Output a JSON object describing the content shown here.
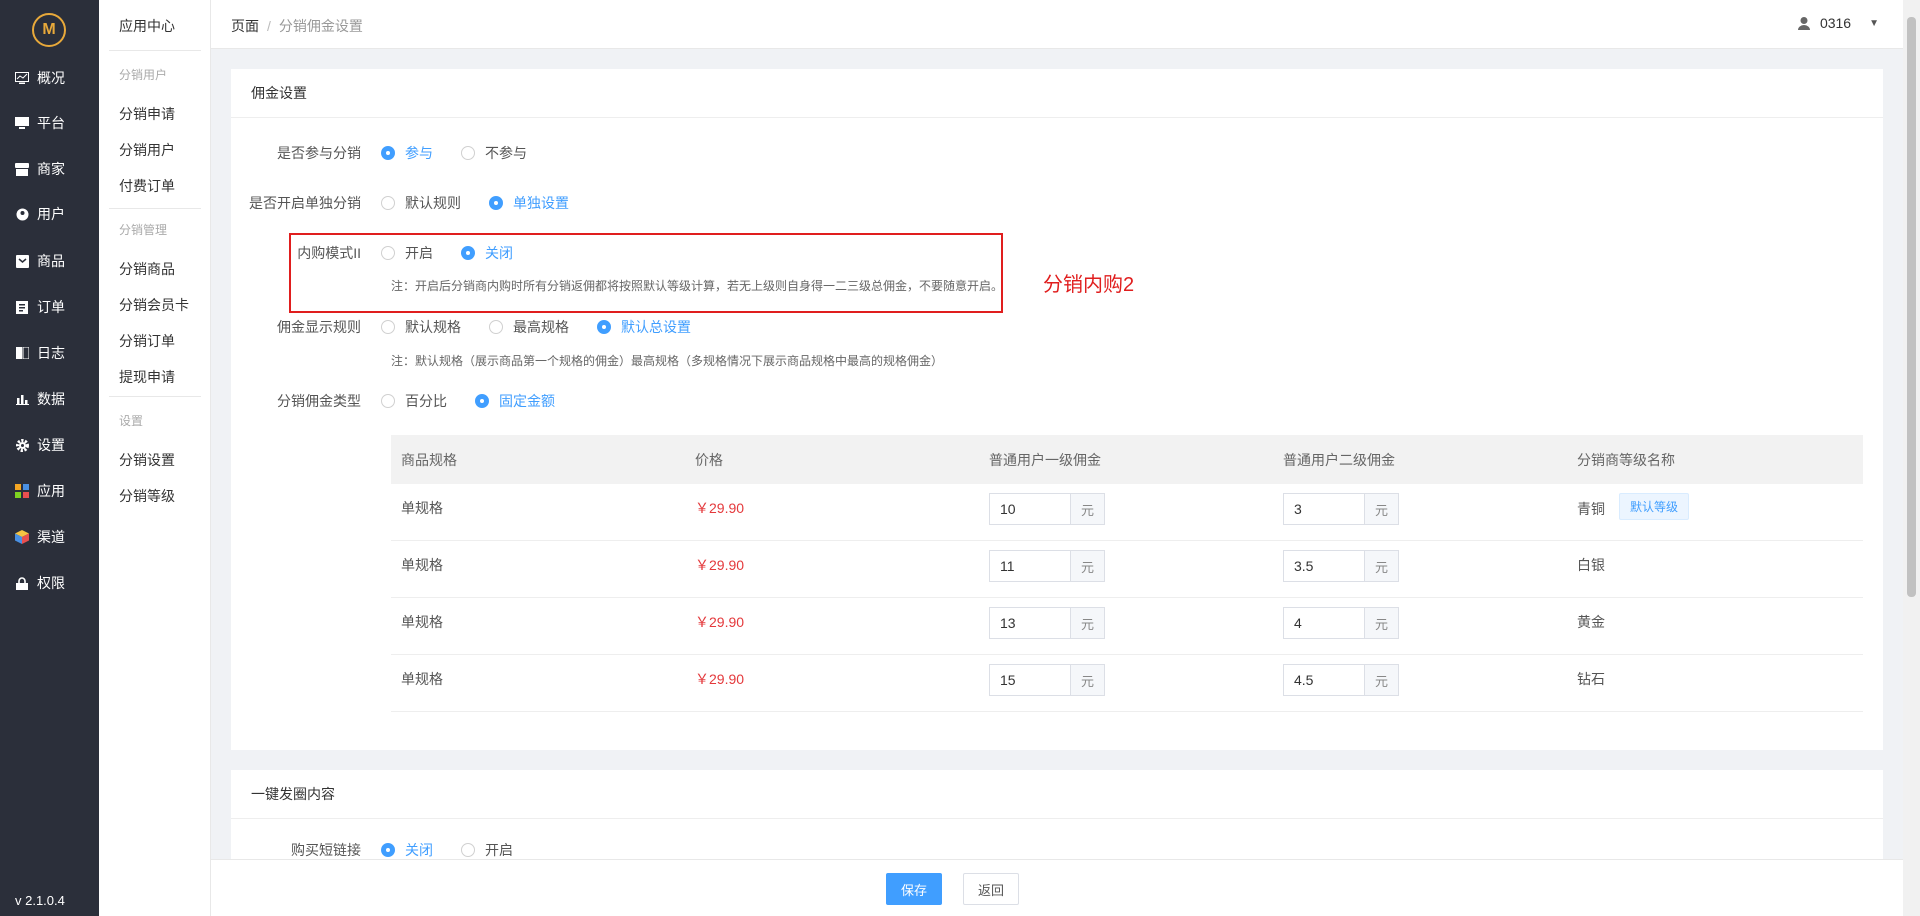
{
  "sidebar": {
    "logo": "M",
    "items": [
      {
        "label": "概况",
        "icon": "dashboard-icon"
      },
      {
        "label": "平台",
        "icon": "monitor-icon"
      },
      {
        "label": "商家",
        "icon": "store-icon"
      },
      {
        "label": "用户",
        "icon": "user-icon"
      },
      {
        "label": "商品",
        "icon": "goods-icon"
      },
      {
        "label": "订单",
        "icon": "order-icon"
      },
      {
        "label": "日志",
        "icon": "log-icon"
      },
      {
        "label": "数据",
        "icon": "bar-chart-icon"
      },
      {
        "label": "设置",
        "icon": "gear-icon"
      },
      {
        "label": "应用",
        "icon": "apps-icon"
      },
      {
        "label": "渠道",
        "icon": "cube-icon"
      },
      {
        "label": "权限",
        "icon": "lock-icon"
      }
    ],
    "version": "v 2.1.0.4"
  },
  "subnav": {
    "title": "应用中心",
    "group1": "分销用户",
    "g1_items": [
      "分销申请",
      "分销用户",
      "付费订单"
    ],
    "group2": "分销管理",
    "g2_items": [
      "分销商品",
      "分销会员卡",
      "分销订单",
      "提现申请"
    ],
    "group3": "设置",
    "g3_items": [
      "分销设置",
      "分销等级"
    ]
  },
  "header": {
    "crumb_root": "页面",
    "crumb_sep": "/",
    "crumb_current": "分销佣金设置",
    "user": "0316"
  },
  "commission": {
    "title": "佣金设置",
    "participate_label": "是否参与分销",
    "participate_opts": [
      "参与",
      "不参与"
    ],
    "single_label": "是否开启单独分销",
    "single_opts": [
      "默认规则",
      "单独设置"
    ],
    "inner_label": "内购模式II",
    "inner_opts": [
      "开启",
      "关闭"
    ],
    "inner_note": "注：开启后分销商内购时所有分销返佣都将按照默认等级计算，若无上级则自身得一二三级总佣金，不要随意开启。",
    "display_label": "佣金显示规则",
    "display_opts": [
      "默认规格",
      "最高规格",
      "默认总设置"
    ],
    "display_note": "注：默认规格（展示商品第一个规格的佣金）最高规格（多规格情况下展示商品规格中最高的规格佣金）",
    "type_label": "分销佣金类型",
    "type_opts": [
      "百分比",
      "固定金额"
    ],
    "annotation": "分销内购2"
  },
  "table": {
    "headers": [
      "商品规格",
      "价格",
      "普通用户一级佣金",
      "普通用户二级佣金",
      "分销商等级名称"
    ],
    "unit": "元",
    "badge": "默认等级",
    "rows": [
      {
        "spec": "单规格",
        "price": "￥29.90",
        "l1": "10",
        "l2": "3",
        "level": "青铜"
      },
      {
        "spec": "单规格",
        "price": "￥29.90",
        "l1": "11",
        "l2": "3.5",
        "level": "白银"
      },
      {
        "spec": "单规格",
        "price": "￥29.90",
        "l1": "13",
        "l2": "4",
        "level": "黄金"
      },
      {
        "spec": "单规格",
        "price": "￥29.90",
        "l1": "15",
        "l2": "4.5",
        "level": "钻石"
      }
    ]
  },
  "moments": {
    "title": "一键发圈内容",
    "link_label": "购买短链接",
    "link_opts": [
      "关闭",
      "开启"
    ]
  },
  "footer": {
    "save": "保存",
    "back": "返回"
  },
  "colors": {
    "primary": "#409eff",
    "sidebar": "#2b2f3a",
    "price": "#e4393c",
    "annotation": "#e01e1e"
  }
}
